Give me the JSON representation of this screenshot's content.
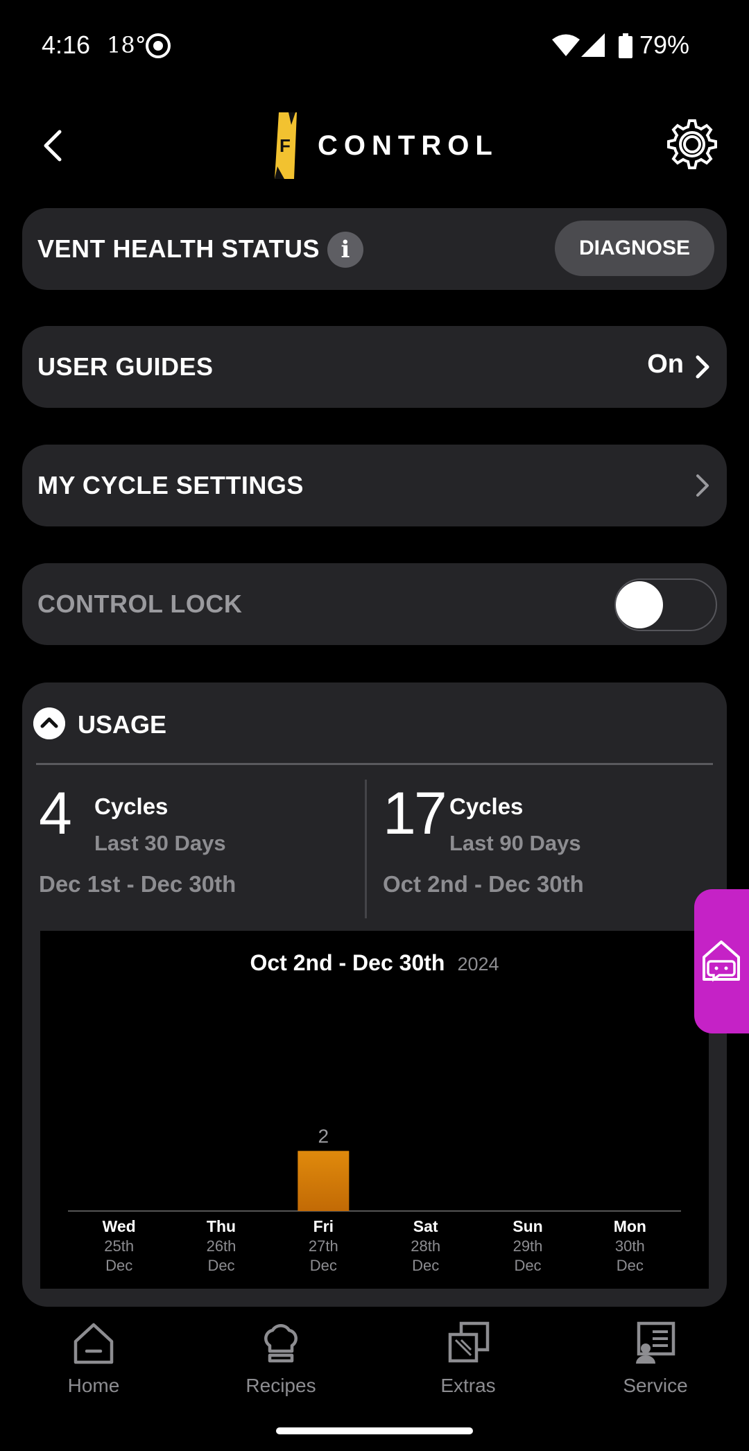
{
  "status_bar": {
    "time": "4:16",
    "temperature": "18°",
    "battery": "79%"
  },
  "header": {
    "title": "CONTROL",
    "logo_letter": "F",
    "logo_color": "#f2c230"
  },
  "vent_health": {
    "label": "VENT HEALTH STATUS",
    "info": "i",
    "button": "DIAGNOSE"
  },
  "user_guides": {
    "label": "USER GUIDES",
    "value": "On"
  },
  "cycle_settings": {
    "label": "MY CYCLE SETTINGS"
  },
  "control_lock": {
    "label": "CONTROL LOCK",
    "enabled": false
  },
  "usage": {
    "title": "USAGE",
    "stats": [
      {
        "count": "4",
        "unit": "Cycles",
        "range": "Last 30 Days",
        "dates": "Dec 1st - Dec 30th"
      },
      {
        "count": "17",
        "unit": "Cycles",
        "range": "Last 90 Days",
        "dates": "Oct 2nd - Dec 30th"
      }
    ]
  },
  "chart_data": {
    "type": "bar",
    "title": "Oct 2nd - Dec 30th",
    "subtitle": "2024",
    "categories": [
      {
        "day": "Wed",
        "date": "25th",
        "month": "Dec"
      },
      {
        "day": "Thu",
        "date": "26th",
        "month": "Dec"
      },
      {
        "day": "Fri",
        "date": "27th",
        "month": "Dec"
      },
      {
        "day": "Sat",
        "date": "28th",
        "month": "Dec"
      },
      {
        "day": "Sun",
        "date": "29th",
        "month": "Dec"
      },
      {
        "day": "Mon",
        "date": "30th",
        "month": "Dec"
      }
    ],
    "values": [
      0,
      0,
      2,
      0,
      0,
      0
    ],
    "data_labels": [
      "",
      "",
      "2",
      "",
      "",
      ""
    ],
    "ylim": [
      0,
      6
    ],
    "bar_color": "#e08a0c",
    "grid": false
  },
  "nav": {
    "items": [
      "Home",
      "Recipes",
      "Extras",
      "Service"
    ]
  },
  "colors": {
    "accent": "#c522c6",
    "card": "#252528"
  }
}
